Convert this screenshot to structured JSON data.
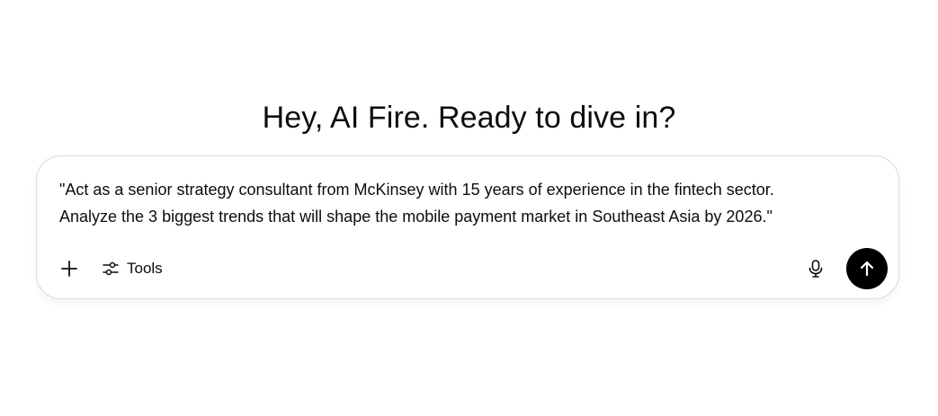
{
  "greeting": "Hey, AI Fire. Ready to dive in?",
  "composer": {
    "prompt_text": "\"Act as a senior strategy consultant from McKinsey with 15 years of experience in the fintech sector.\nAnalyze the 3 biggest trends that will shape the mobile payment market in Southeast Asia by 2026.\"",
    "tools_label": "Tools",
    "icons": {
      "add": "plus-icon",
      "tools": "sliders-icon",
      "voice": "microphone-icon",
      "send": "arrow-up-icon"
    },
    "send_button_color": "#000000"
  }
}
